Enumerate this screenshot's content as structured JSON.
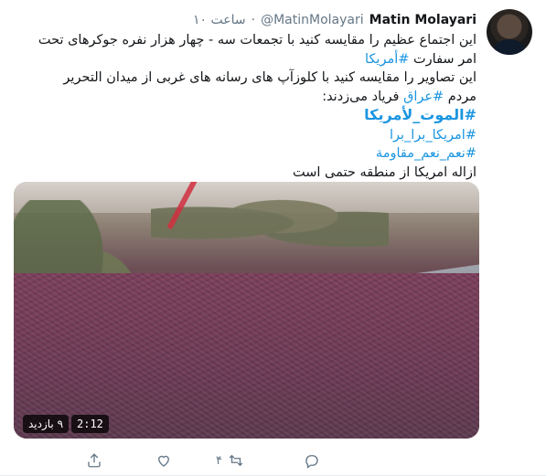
{
  "tweet": {
    "author_name": "Matin Molayari",
    "author_handle": "@MatinMolayari",
    "separator": "·",
    "time": "۱۰ ساعت",
    "lines": [
      "این اجتماع عظیم را مقایسه کنید با تجمعات سه - چهار هزار نفره جوکرهای تحت",
      "امر سفارت",
      "این تصاویر را مقایسه کنید با کلوزآپ های رسانه های غربی از میدان التحریر",
      "مردم",
      "فریاد می‌زدند:",
      "ازاله امریکا از منطقه حتمی است"
    ],
    "hashtags": {
      "america": "#أمریکا",
      "iraq": "#عراق",
      "death": "#الموت_لأمریکا",
      "out": "#امریکا_برا_برا",
      "resist": "#نعم_نعم_مقاومة"
    }
  },
  "media": {
    "duration": "2:12",
    "views": "۹ بازدید"
  },
  "actions": {
    "reply_count": "",
    "retweet_count": "۴",
    "like_count": "",
    "share_count": ""
  }
}
